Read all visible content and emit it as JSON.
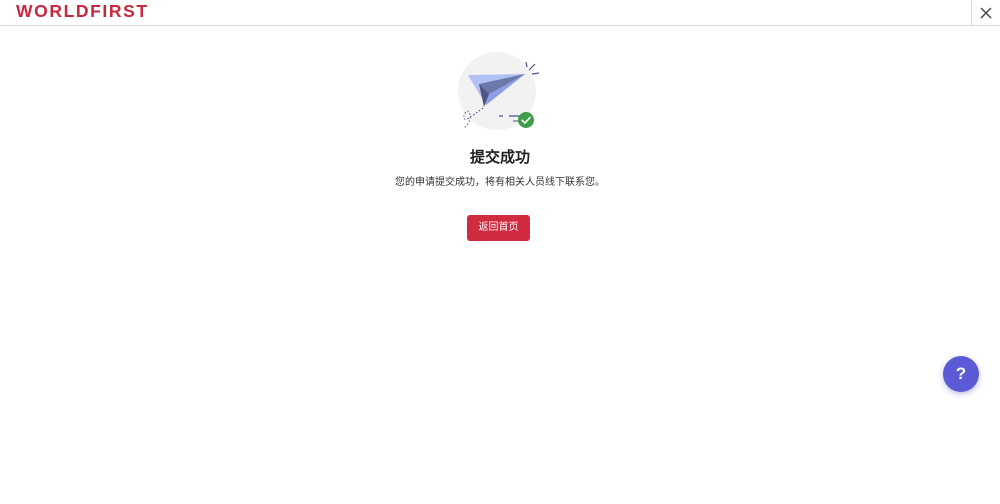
{
  "header": {
    "logo_text": "WORLDFIRST",
    "close_icon": "close-icon"
  },
  "result": {
    "illustration_icon": "paper-plane-icon",
    "status_icon": "check-circle-icon",
    "title": "提交成功",
    "description": "您的申请提交成功，将有相关人员线下联系您。",
    "back_button_label": "返回首页"
  },
  "help": {
    "label": "?",
    "icon": "help-icon"
  },
  "colors": {
    "brand": "#c8283e",
    "button": "#d12b3f",
    "help": "#5b5bd6",
    "success": "#3f9d4a"
  }
}
